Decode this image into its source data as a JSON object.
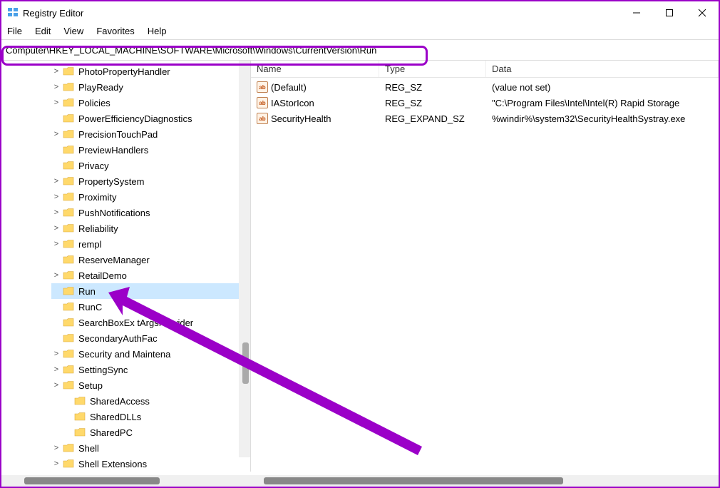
{
  "window": {
    "title": "Registry Editor"
  },
  "menu": {
    "file": "File",
    "edit": "Edit",
    "view": "View",
    "favorites": "Favorites",
    "help": "Help"
  },
  "address": {
    "value": "Computer\\HKEY_LOCAL_MACHINE\\SOFTWARE\\Microsoft\\Windows\\CurrentVersion\\Run"
  },
  "tree": [
    {
      "exp": ">",
      "label": "PhotoPropertyHandler",
      "child": false
    },
    {
      "exp": ">",
      "label": "PlayReady",
      "child": false
    },
    {
      "exp": ">",
      "label": "Policies",
      "child": false
    },
    {
      "exp": "",
      "label": "PowerEfficiencyDiagnostics",
      "child": false
    },
    {
      "exp": ">",
      "label": "PrecisionTouchPad",
      "child": false
    },
    {
      "exp": "",
      "label": "PreviewHandlers",
      "child": false
    },
    {
      "exp": "",
      "label": "Privacy",
      "child": false
    },
    {
      "exp": ">",
      "label": "PropertySystem",
      "child": false
    },
    {
      "exp": ">",
      "label": "Proximity",
      "child": false
    },
    {
      "exp": ">",
      "label": "PushNotifications",
      "child": false
    },
    {
      "exp": ">",
      "label": "Reliability",
      "child": false
    },
    {
      "exp": ">",
      "label": "rempl",
      "child": false
    },
    {
      "exp": "",
      "label": "ReserveManager",
      "child": false
    },
    {
      "exp": ">",
      "label": "RetailDemo",
      "child": false
    },
    {
      "exp": "",
      "label": "Run",
      "child": false,
      "selected": true
    },
    {
      "exp": "",
      "label": "RunOnce",
      "child": false,
      "cut": "RunC"
    },
    {
      "exp": "",
      "label": "SearchBoxExperimentArgsProvider",
      "child": false,
      "cut": "SearchBoxEx       tArgsProvider"
    },
    {
      "exp": "",
      "label": "SecondaryAuthFactor",
      "child": false,
      "cut": "SecondaryAuthFac"
    },
    {
      "exp": ">",
      "label": "Security and Maintenance",
      "child": false,
      "cut": "Security and Maintena"
    },
    {
      "exp": ">",
      "label": "SettingSync",
      "child": false
    },
    {
      "exp": ">",
      "label": "Setup",
      "child": false
    },
    {
      "exp": "",
      "label": "SharedAccess",
      "child": true
    },
    {
      "exp": "",
      "label": "SharedDLLs",
      "child": true
    },
    {
      "exp": "",
      "label": "SharedPC",
      "child": true
    },
    {
      "exp": ">",
      "label": "Shell",
      "child": false
    },
    {
      "exp": ">",
      "label": "Shell Extensions",
      "child": false
    }
  ],
  "columns": {
    "name": "Name",
    "type": "Type",
    "data": "Data"
  },
  "values": [
    {
      "name": "(Default)",
      "type": "REG_SZ",
      "data": "(value not set)"
    },
    {
      "name": "IAStorIcon",
      "type": "REG_SZ",
      "data": "\"C:\\Program Files\\Intel\\Intel(R) Rapid Storage "
    },
    {
      "name": "SecurityHealth",
      "type": "REG_EXPAND_SZ",
      "data": "%windir%\\system32\\SecurityHealthSystray.exe"
    }
  ]
}
